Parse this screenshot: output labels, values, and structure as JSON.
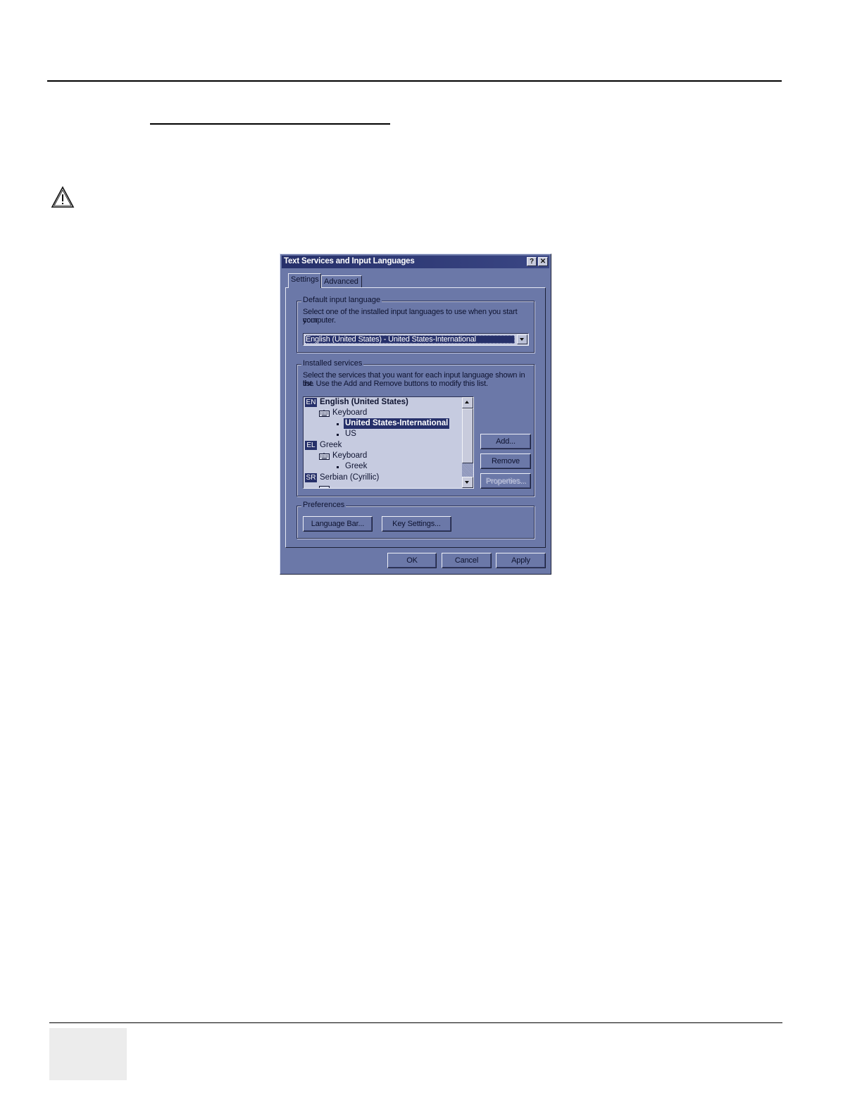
{
  "dialog": {
    "title": "Text Services and Input Languages",
    "help_label": "?",
    "close_label": "✕",
    "tabs": [
      {
        "label": "Settings",
        "active": true
      },
      {
        "label": "Advanced",
        "active": false
      }
    ],
    "default_input_language": {
      "legend": "Default input language",
      "description_line1": "Select one of the installed input languages to use when you start your",
      "description_line2": "computer.",
      "selected": "English (United States) - United States-International"
    },
    "installed_services": {
      "legend": "Installed services",
      "description_line1": "Select the services that you want for each input language shown in the",
      "description_line2": "list. Use the Add and Remove buttons to modify this list.",
      "items": {
        "en_badge": "EN",
        "en_name": "English (United States)",
        "en_keyboard": "Keyboard",
        "en_layout_1": "United States-International",
        "en_layout_2": "US",
        "el_badge": "EL",
        "el_name": "Greek",
        "el_keyboard": "Keyboard",
        "el_layout_1": "Greek",
        "sr_badge": "SR",
        "sr_name": "Serbian (Cyrillic)"
      },
      "add_label": "Add...",
      "remove_label": "Remove",
      "properties_label": "Properties..."
    },
    "preferences": {
      "legend": "Preferences",
      "language_bar_label": "Language Bar...",
      "key_settings_label": "Key Settings..."
    },
    "ok_label": "OK",
    "cancel_label": "Cancel",
    "apply_label": "Apply"
  }
}
